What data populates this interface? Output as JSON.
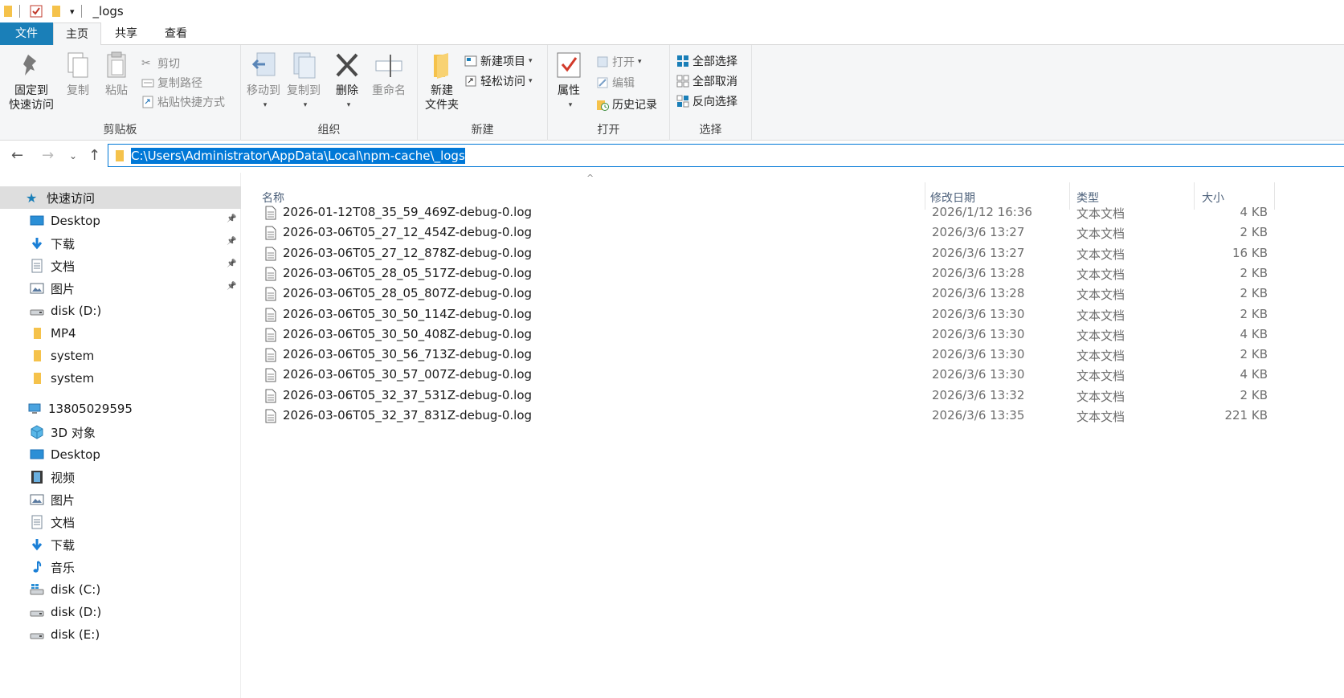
{
  "window": {
    "title": "_logs"
  },
  "ribbon_tabs": [
    "文件",
    "主页",
    "共享",
    "查看"
  ],
  "ribbon": {
    "clipboard": {
      "label": "剪贴板",
      "pin": "固定到\n快速访问",
      "pin_l1": "固定到",
      "pin_l2": "快速访问",
      "copy": "复制",
      "paste": "粘贴",
      "cut": "剪切",
      "copy_path": "复制路径",
      "paste_shortcut": "粘贴快捷方式"
    },
    "organize": {
      "label": "组织",
      "move_to": "移动到",
      "copy_to": "复制到",
      "delete": "删除",
      "rename": "重命名"
    },
    "new": {
      "label": "新建",
      "new_folder_l1": "新建",
      "new_folder_l2": "文件夹",
      "new_item": "新建项目",
      "easy_access": "轻松访问"
    },
    "open": {
      "label": "打开",
      "properties": "属性",
      "open": "打开",
      "edit": "编辑",
      "history": "历史记录"
    },
    "select": {
      "label": "选择",
      "select_all": "全部选择",
      "select_none": "全部取消",
      "invert": "反向选择"
    }
  },
  "address": {
    "path": "C:\\Users\\Administrator\\AppData\\Local\\npm-cache\\_logs"
  },
  "sidebar": {
    "quick_access": "快速访问",
    "quick_items": [
      {
        "label": "Desktop",
        "icon": "desktop-icon",
        "pinned": true
      },
      {
        "label": "下载",
        "icon": "download-icon",
        "pinned": true
      },
      {
        "label": "文档",
        "icon": "document-icon",
        "pinned": true
      },
      {
        "label": "图片",
        "icon": "pictures-icon",
        "pinned": true
      },
      {
        "label": "disk (D:)",
        "icon": "drive-icon",
        "pinned": false
      },
      {
        "label": "MP4",
        "icon": "folder-icon",
        "pinned": false
      },
      {
        "label": "system",
        "icon": "folder-icon",
        "pinned": false
      },
      {
        "label": "system",
        "icon": "folder-icon",
        "pinned": false
      }
    ],
    "this_pc": "13805029595",
    "pc_items": [
      {
        "label": "3D 对象",
        "icon": "3d-objects-icon"
      },
      {
        "label": "Desktop",
        "icon": "desktop-icon"
      },
      {
        "label": "视频",
        "icon": "video-icon"
      },
      {
        "label": "图片",
        "icon": "pictures-icon"
      },
      {
        "label": "文档",
        "icon": "document-icon"
      },
      {
        "label": "下载",
        "icon": "download-icon"
      },
      {
        "label": "音乐",
        "icon": "music-icon"
      },
      {
        "label": "disk (C:)",
        "icon": "system-drive-icon"
      },
      {
        "label": "disk (D:)",
        "icon": "drive-icon"
      },
      {
        "label": "disk (E:)",
        "icon": "drive-icon"
      }
    ]
  },
  "columns": {
    "name": "名称",
    "date": "修改日期",
    "type": "类型",
    "size": "大小"
  },
  "files": [
    {
      "name": "2026-01-12T08_35_59_469Z-debug-0.log",
      "date": "2026/1/12 16:36",
      "type": "文本文档",
      "size": "4 KB"
    },
    {
      "name": "2026-03-06T05_27_12_454Z-debug-0.log",
      "date": "2026/3/6 13:27",
      "type": "文本文档",
      "size": "2 KB"
    },
    {
      "name": "2026-03-06T05_27_12_878Z-debug-0.log",
      "date": "2026/3/6 13:27",
      "type": "文本文档",
      "size": "16 KB"
    },
    {
      "name": "2026-03-06T05_28_05_517Z-debug-0.log",
      "date": "2026/3/6 13:28",
      "type": "文本文档",
      "size": "2 KB"
    },
    {
      "name": "2026-03-06T05_28_05_807Z-debug-0.log",
      "date": "2026/3/6 13:28",
      "type": "文本文档",
      "size": "2 KB"
    },
    {
      "name": "2026-03-06T05_30_50_114Z-debug-0.log",
      "date": "2026/3/6 13:30",
      "type": "文本文档",
      "size": "2 KB"
    },
    {
      "name": "2026-03-06T05_30_50_408Z-debug-0.log",
      "date": "2026/3/6 13:30",
      "type": "文本文档",
      "size": "4 KB"
    },
    {
      "name": "2026-03-06T05_30_56_713Z-debug-0.log",
      "date": "2026/3/6 13:30",
      "type": "文本文档",
      "size": "2 KB"
    },
    {
      "name": "2026-03-06T05_30_57_007Z-debug-0.log",
      "date": "2026/3/6 13:30",
      "type": "文本文档",
      "size": "4 KB"
    },
    {
      "name": "2026-03-06T05_32_37_531Z-debug-0.log",
      "date": "2026/3/6 13:32",
      "type": "文本文档",
      "size": "2 KB"
    },
    {
      "name": "2026-03-06T05_32_37_831Z-debug-0.log",
      "date": "2026/3/6 13:35",
      "type": "文本文档",
      "size": "221 KB"
    }
  ],
  "colors": {
    "accent": "#0078d7",
    "file_tab": "#1a7fb8",
    "ribbon_bg": "#f5f6f7",
    "folder": "#f5c24b"
  }
}
